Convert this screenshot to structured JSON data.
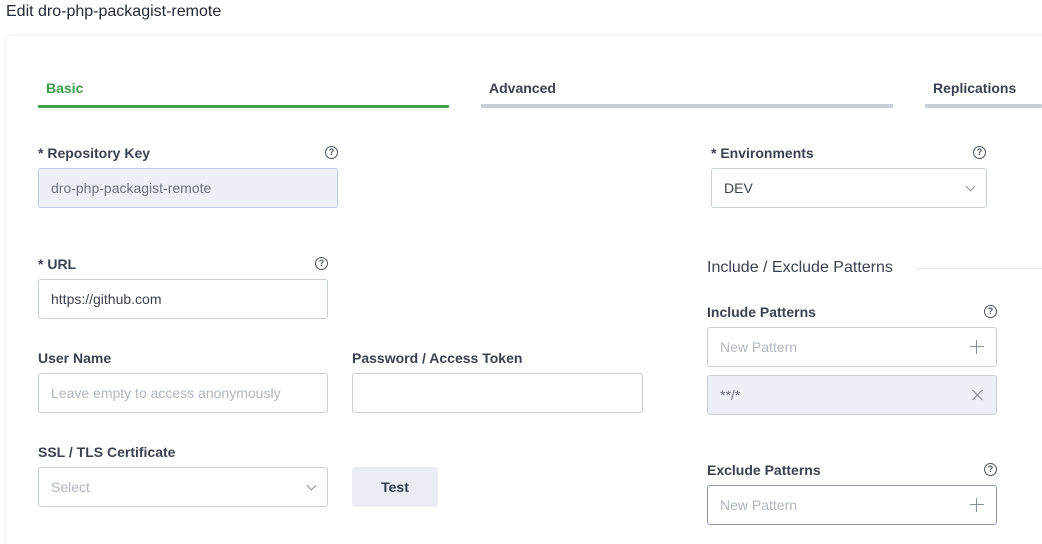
{
  "page": {
    "title": "Edit dro-php-packagist-remote"
  },
  "tabs": [
    {
      "label": "Basic",
      "active": true
    },
    {
      "label": "Advanced",
      "active": false
    },
    {
      "label": "Replications",
      "active": false
    }
  ],
  "form": {
    "repository_key": {
      "label": "* Repository Key",
      "value": "dro-php-packagist-remote"
    },
    "url": {
      "label": "* URL",
      "value": "https://github.com"
    },
    "user_name": {
      "label": "User Name",
      "placeholder": "Leave empty to access anonymously"
    },
    "password": {
      "label": "Password / Access Token",
      "value": ""
    },
    "ssl_certificate": {
      "label": "SSL / TLS Certificate",
      "placeholder": "Select"
    },
    "test_button": "Test",
    "environments": {
      "label": "* Environments",
      "value": "DEV"
    },
    "patterns_section": "Include / Exclude Patterns",
    "include_patterns": {
      "label": "Include Patterns",
      "placeholder": "New Pattern",
      "items": [
        "**/*"
      ]
    },
    "exclude_patterns": {
      "label": "Exclude Patterns",
      "placeholder": "New Pattern"
    }
  },
  "icons": {
    "help": "help-circle-icon",
    "dropdown": "chevron-down-icon",
    "add": "plus-icon",
    "remove": "close-icon"
  },
  "colors": {
    "active_tab": "#43a047",
    "inactive_tab_line": "#c9ced8",
    "disabled_field_bg": "#eef0f7"
  }
}
